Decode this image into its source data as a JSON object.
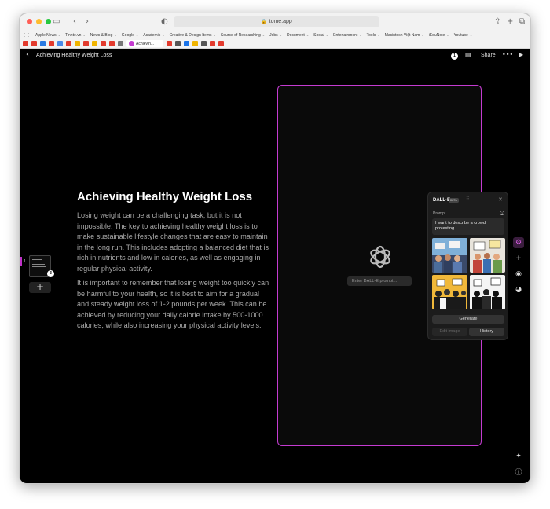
{
  "browser": {
    "url": "tome.app",
    "bookmarks": [
      "Apple News",
      "Tinhte.vn",
      "News & Blog",
      "Google",
      "Academic",
      "Creative & Design Items",
      "Source of Researching",
      "Jobs",
      "Document",
      "Social",
      "Entertainment",
      "Tools",
      "Macintosh Việt Nam",
      "iEduNote",
      "Youtube"
    ],
    "active_tab": "Achievin...",
    "fav_colors": [
      "#e23b2e",
      "#e23b2e",
      "#2a7ae2",
      "#e23b2e",
      "#4a8ae8",
      "#e23b2e",
      "#f0b400",
      "#e23b2e",
      "#f0b400",
      "#e23b2e",
      "#e23b2e",
      "#777777",
      "#e23b2e",
      "#555555",
      "#1a73e8",
      "#f0b400",
      "#555555",
      "#e23b2e",
      "#e23b2e"
    ]
  },
  "app": {
    "doc_title": "Achieving Healthy Weight Loss",
    "share_label": "Share",
    "notification_count": "1"
  },
  "sidebar": {
    "slide_number": "1",
    "slide_badge": "3",
    "add_label": "+"
  },
  "slide": {
    "title": "Achieving Healthy Weight Loss",
    "paragraph1": "Losing weight can be a challenging task, but it is not impossible. The key to achieving healthy weight loss is to make sustainable lifestyle changes that are easy to maintain in the long run. This includes adopting a balanced diet that is rich in nutrients and low in calories, as well as engaging in regular physical activity.",
    "paragraph2": "It is important to remember that losing weight too quickly can be harmful to your health, so it is best to aim for a gradual and steady weight loss of 1-2 pounds per week. This can be achieved by reducing your daily calorie intake by 500-1000 calories, while also increasing your physical activity levels.",
    "prompt_placeholder": "Enter DALL-E prompt..."
  },
  "dalle": {
    "name": "DALL·E",
    "beta": "BETA",
    "prompt_label": "Prompt",
    "prompt_text": "I want to describe a crowd protesting",
    "generate": "Generate",
    "edit_image": "Edit image",
    "history": "History"
  },
  "colors": {
    "accent": "#c43bd0",
    "background": "#000000"
  }
}
